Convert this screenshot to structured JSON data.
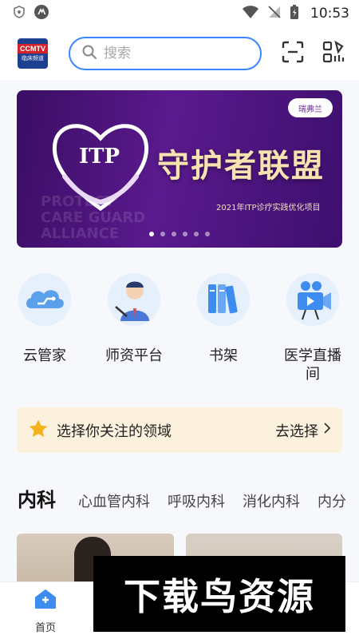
{
  "status_bar": {
    "time": "10:53"
  },
  "header": {
    "logo_text_top": "CCMTV",
    "logo_text_bottom": "临床频道",
    "search_placeholder": "搜索"
  },
  "banner": {
    "title": "守护者联盟",
    "subtitle": "2021年ITP诊疗实践优化项目",
    "heart_text": "ITP",
    "badge_text": "瑞弗兰",
    "background_text": "PROTECT CARE GUARD ALLIANCE",
    "slide_count": 6,
    "active_slide": 1
  },
  "quick_links": [
    {
      "label": "云管家",
      "icon": "cloud-icon"
    },
    {
      "label": "师资平台",
      "icon": "teacher-icon"
    },
    {
      "label": "书架",
      "icon": "bookshelf-icon"
    },
    {
      "label": "医学直播间",
      "icon": "video-camera-icon"
    }
  ],
  "focus_bar": {
    "text": "选择你关注的领域",
    "action": "去选择"
  },
  "category_tabs": {
    "main": "内科",
    "items": [
      "心血管内科",
      "呼吸内科",
      "消化内科",
      "内分"
    ]
  },
  "bottom_nav": {
    "home_label": "首页"
  },
  "watermark": {
    "text": "下载鸟资源"
  },
  "colors": {
    "accent": "#3a86ff",
    "banner_purple": "#4a1478",
    "focus_bg": "#fcf1dc",
    "star": "#f5b21b"
  }
}
